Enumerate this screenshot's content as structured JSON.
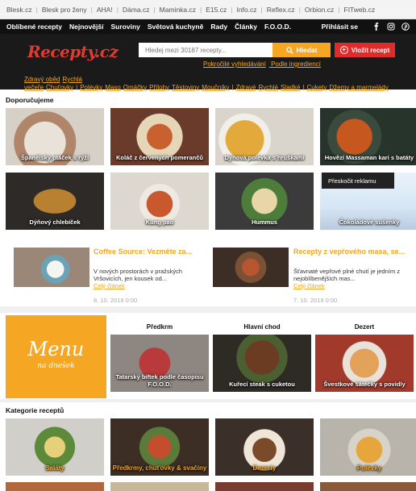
{
  "netbar": {
    "links": [
      "Blesk.cz",
      "Blesk pro ženy",
      "AHA!",
      "Dáma.cz",
      "Maminka.cz",
      "E15.cz",
      "Info.cz",
      "Reflex.cz",
      "Orbion.cz",
      "FITweb.cz"
    ]
  },
  "nav": {
    "items": [
      "Oblíbené recepty",
      "Nejnovější",
      "Suroviny",
      "Světová kuchyně",
      "Rady",
      "Články",
      "F.O.O.D."
    ],
    "login": "Přihlásit se",
    "social": [
      "facebook-icon",
      "instagram-icon",
      "pinterest-icon"
    ]
  },
  "header": {
    "logo": "Recepty.cz",
    "search_placeholder": "Hledej mezi 30187 recepty...",
    "search_button": "Hledat",
    "add_button": "Vložit recept",
    "adv_links": [
      "Pokročilé vyhledávání",
      "Podle ingrediencí"
    ],
    "quick_links": [
      "Zdravý oběd",
      "Rychlá večeře",
      "Chuťovky",
      "|",
      "Polévky",
      "Maso",
      "Omáčky",
      "Přílohy",
      "Těstoviny",
      "Moučníky",
      "|",
      "Zdravé",
      "Rychlé",
      "Sladké",
      "|",
      "Cukety",
      "Džemy a marmelády"
    ]
  },
  "recommended": {
    "title": "Doporučujeme",
    "row1": [
      "Španělský ptáček s rýží",
      "Koláč z červených pomerančů",
      "Dýňová polévka s hruškami",
      "Hovězí Massaman kari s batáty"
    ],
    "row2": [
      "Dýňový chlebíček",
      "Kung pao",
      "Hummus",
      "Čokoládové sušenky"
    ],
    "skip_ad": "Přeskočit reklamu"
  },
  "articles": [
    {
      "title": "Coffee Source: Vezměte za...",
      "text": "V nových prostorách v pražských Vršovicích, jen kousek od...",
      "link": "Celý článek",
      "date": "8. 10. 2019 0:00"
    },
    {
      "title": "Recepty z vepřového masa, se...",
      "text": "Šťavnaté vepřové plné chutí je jedním z nejoblíbenějších mas...",
      "link": "Celý článek",
      "date": "7. 10. 2019 0:00"
    }
  ],
  "menu": {
    "big": "Menu",
    "small": "na dnešek",
    "columns": [
      "Předkrm",
      "Hlavní chod",
      "Dezert"
    ],
    "dishes": [
      "Tatarský biftek podle časopisu F.O.O.D.",
      "Kuřecí steak s cuketou",
      "Švestkové šátečky s povidly"
    ]
  },
  "categories": {
    "title": "Kategorie receptů",
    "items": [
      "Saláty",
      "Předkrmy, chuťovky & svačiny",
      "Dezerty",
      "Polévky"
    ]
  },
  "colors": {
    "accent": "#f5a623",
    "red": "#e02b2b",
    "dark": "#111111"
  }
}
